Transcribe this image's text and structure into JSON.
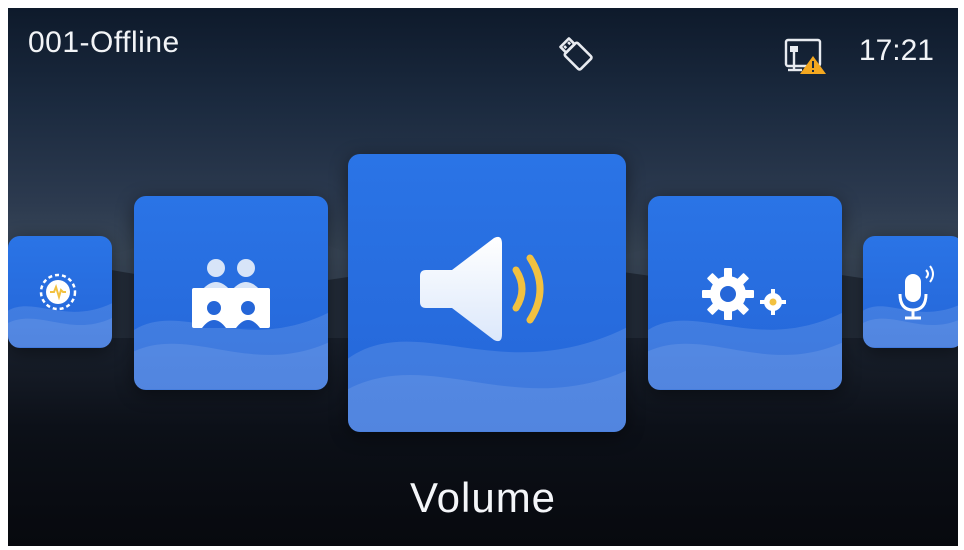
{
  "status_bar": {
    "title": "001-Offline",
    "clock": "17:21",
    "icons": [
      "usb-icon",
      "network-warning-icon"
    ]
  },
  "carousel": {
    "selected": "Volume",
    "items": [
      {
        "icon": "monitor-wave-icon"
      },
      {
        "icon": "conference-icon"
      },
      {
        "icon": "volume-icon"
      },
      {
        "icon": "settings-gears-icon"
      },
      {
        "icon": "microphone-icon"
      }
    ]
  },
  "colors": {
    "tile_blue": "#2a6ee0",
    "wave_light": "#6fa6f2",
    "accent_yellow": "#f2c140",
    "warning_orange": "#f4a820"
  }
}
